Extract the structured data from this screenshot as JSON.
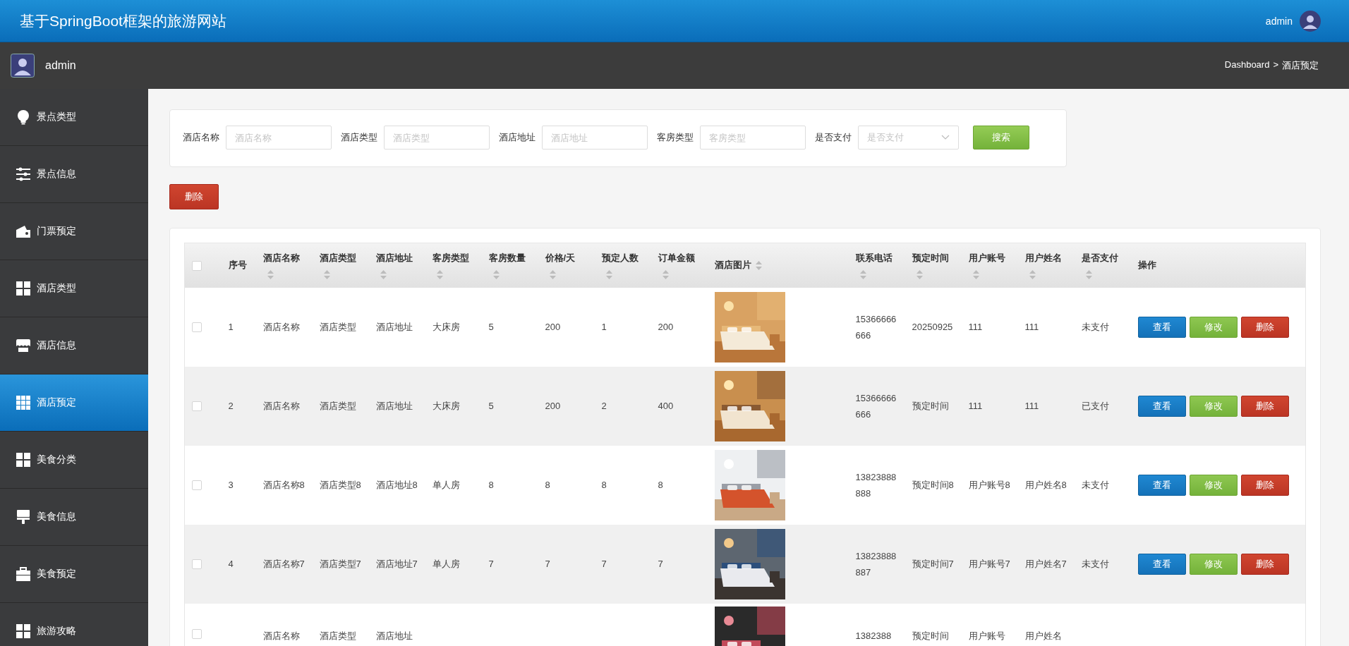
{
  "header": {
    "title": "基于SpringBoot框架的旅游网站",
    "user": "admin"
  },
  "topbar": {
    "user": "admin",
    "breadcrumb": [
      "Dashboard",
      "酒店预定"
    ],
    "separator": ">"
  },
  "sidebar": {
    "items": [
      {
        "label": "景点类型",
        "selected": false
      },
      {
        "label": "景点信息",
        "selected": false
      },
      {
        "label": "门票预定",
        "selected": false
      },
      {
        "label": "酒店类型",
        "selected": false
      },
      {
        "label": "酒店信息",
        "selected": false
      },
      {
        "label": "酒店预定",
        "selected": true
      },
      {
        "label": "美食分类",
        "selected": false
      },
      {
        "label": "美食信息",
        "selected": false
      },
      {
        "label": "美食预定",
        "selected": false
      },
      {
        "label": "旅游攻略",
        "selected": false
      }
    ]
  },
  "search": {
    "fields": [
      {
        "label": "酒店名称",
        "placeholder": "酒店名称",
        "kind": "text"
      },
      {
        "label": "酒店类型",
        "placeholder": "酒店类型",
        "kind": "text"
      },
      {
        "label": "酒店地址",
        "placeholder": "酒店地址",
        "kind": "text"
      },
      {
        "label": "客房类型",
        "placeholder": "客房类型",
        "kind": "text"
      },
      {
        "label": "是否支付",
        "placeholder": "是否支付",
        "kind": "select"
      }
    ],
    "button": "搜索"
  },
  "delete_button": "删除",
  "table": {
    "all_checked": false,
    "columns": [
      {
        "label": "序号",
        "sortable": false,
        "kind": "text"
      },
      {
        "label": "酒店名称",
        "sortable": true,
        "kind": "text"
      },
      {
        "label": "酒店类型",
        "sortable": true,
        "kind": "text"
      },
      {
        "label": "酒店地址",
        "sortable": true,
        "kind": "text"
      },
      {
        "label": "客房类型",
        "sortable": true,
        "kind": "text"
      },
      {
        "label": "客房数量",
        "sortable": true,
        "kind": "text"
      },
      {
        "label": "价格/天",
        "sortable": true,
        "kind": "text"
      },
      {
        "label": "预定人数",
        "sortable": true,
        "kind": "text"
      },
      {
        "label": "订单金额",
        "sortable": true,
        "kind": "text"
      },
      {
        "label": "酒店图片",
        "sortable": true
      },
      {
        "label": "联系电话",
        "sortable": true,
        "kind": "text"
      },
      {
        "label": "预定时间",
        "sortable": true,
        "kind": "text"
      },
      {
        "label": "用户账号",
        "sortable": true,
        "kind": "text"
      },
      {
        "label": "用户姓名",
        "sortable": true,
        "kind": "text"
      },
      {
        "label": "是否支付",
        "sortable": true,
        "kind": "text"
      },
      {
        "label": "操作",
        "sortable": false,
        "kind": "actions"
      }
    ],
    "rows": [
      {
        "checked": false,
        "cells": [
          "1",
          "酒店名称",
          "酒店类型",
          "酒店地址",
          "大床房",
          "5",
          "200",
          "1",
          "200",
          {
            "kind": "picture"
          },
          "15366666666",
          "20250925",
          "111",
          "111",
          "未支付"
        ],
        "actions": [
          {
            "label": "查看",
            "kind": "view"
          },
          {
            "label": "修改",
            "kind": "edit"
          },
          {
            "label": "删除",
            "kind": "delete"
          }
        ]
      },
      {
        "checked": false,
        "cells": [
          "2",
          "酒店名称",
          "酒店类型",
          "酒店地址",
          "大床房",
          "5",
          "200",
          "2",
          "400",
          {
            "kind": "picture"
          },
          "15366666666",
          "预定时间",
          "111",
          "111",
          "已支付"
        ],
        "actions": [
          {
            "label": "查看",
            "kind": "view"
          },
          {
            "label": "修改",
            "kind": "edit"
          },
          {
            "label": "删除",
            "kind": "delete"
          }
        ]
      },
      {
        "checked": false,
        "cells": [
          "3",
          "酒店名称8",
          "酒店类型8",
          "酒店地址8",
          "单人房",
          "8",
          "8",
          "8",
          "8",
          {
            "kind": "picture"
          },
          "13823888888",
          "预定时间8",
          "用户账号8",
          "用户姓名8",
          "未支付"
        ],
        "actions": [
          {
            "label": "查看",
            "kind": "view"
          },
          {
            "label": "修改",
            "kind": "edit"
          },
          {
            "label": "删除",
            "kind": "delete"
          }
        ]
      },
      {
        "checked": false,
        "cells": [
          "4",
          "酒店名称7",
          "酒店类型7",
          "酒店地址7",
          "单人房",
          "7",
          "7",
          "7",
          "7",
          {
            "kind": "picture"
          },
          "13823888887",
          "预定时间7",
          "用户账号7",
          "用户姓名7",
          "未支付"
        ],
        "actions": [
          {
            "label": "查看",
            "kind": "view"
          },
          {
            "label": "修改",
            "kind": "edit"
          },
          {
            "label": "删除",
            "kind": "delete"
          }
        ]
      },
      {
        "checked": false,
        "cells": [
          null,
          "酒店名称",
          "酒店类型",
          "酒店地址",
          null,
          null,
          null,
          null,
          null,
          {
            "kind": "picture"
          },
          "1382388",
          "预定时间",
          "用户账号",
          "用户姓名",
          null
        ]
      }
    ]
  }
}
